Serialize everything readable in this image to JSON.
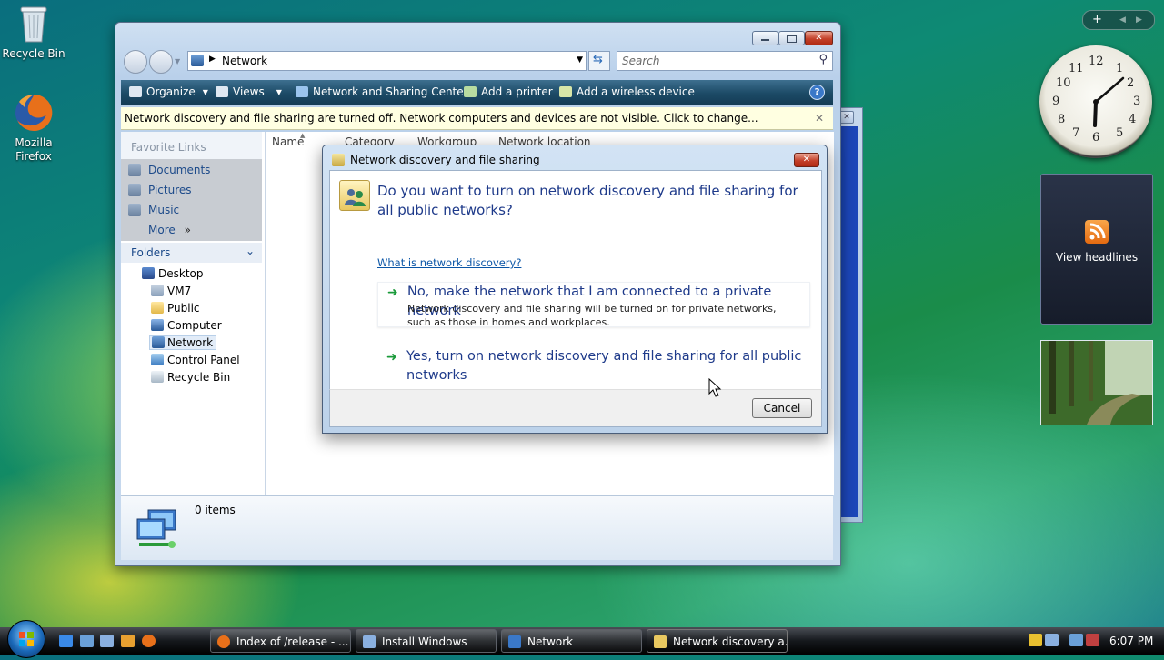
{
  "desktop": {
    "icons": [
      {
        "label": "Recycle Bin"
      },
      {
        "label": "Mozilla Firefox"
      }
    ]
  },
  "gadgets": {
    "clock_numbers": [
      "12",
      "1",
      "2",
      "3",
      "4",
      "5",
      "6",
      "7",
      "8",
      "9",
      "10",
      "11"
    ],
    "feed_label": "View headlines"
  },
  "explorer": {
    "address": "Network",
    "search_placeholder": "Search",
    "toolbar": {
      "organize": "Organize",
      "views": "Views",
      "network_center": "Network and Sharing Center",
      "add_printer": "Add a printer",
      "add_wireless": "Add a wireless device"
    },
    "infobar": "Network discovery and file sharing are turned off. Network computers and devices are not visible. Click to change...",
    "favorite_links_title": "Favorite Links",
    "favorite_links": [
      "Documents",
      "Pictures",
      "Music",
      "More"
    ],
    "folders_title": "Folders",
    "tree": [
      "Desktop",
      "VM7",
      "Public",
      "Computer",
      "Network",
      "Control Panel",
      "Recycle Bin"
    ],
    "columns": [
      "Name",
      "Category",
      "Workgroup",
      "Network location"
    ],
    "item_count": "0 items"
  },
  "dialog": {
    "title": "Network discovery and file sharing",
    "question": "Do you want to turn on network discovery and file sharing for all public networks?",
    "link": "What is network discovery?",
    "option1_title": "No, make the network that I am connected to a private network",
    "option1_desc": "Network discovery and file sharing will be turned on for private networks, such as those in homes and workplaces.",
    "option2_title": "Yes, turn on network discovery and file sharing for all public networks",
    "cancel": "Cancel"
  },
  "taskbar": {
    "tasks": [
      "Index of /release - ...",
      "Install Windows",
      "Network",
      "Network discovery a..."
    ],
    "time": "6:07 PM"
  },
  "colors": {
    "toolbar": "#1c4a66",
    "link": "#0a55a6",
    "heading": "#1e3a8a",
    "infobar": "#ffffe1"
  }
}
